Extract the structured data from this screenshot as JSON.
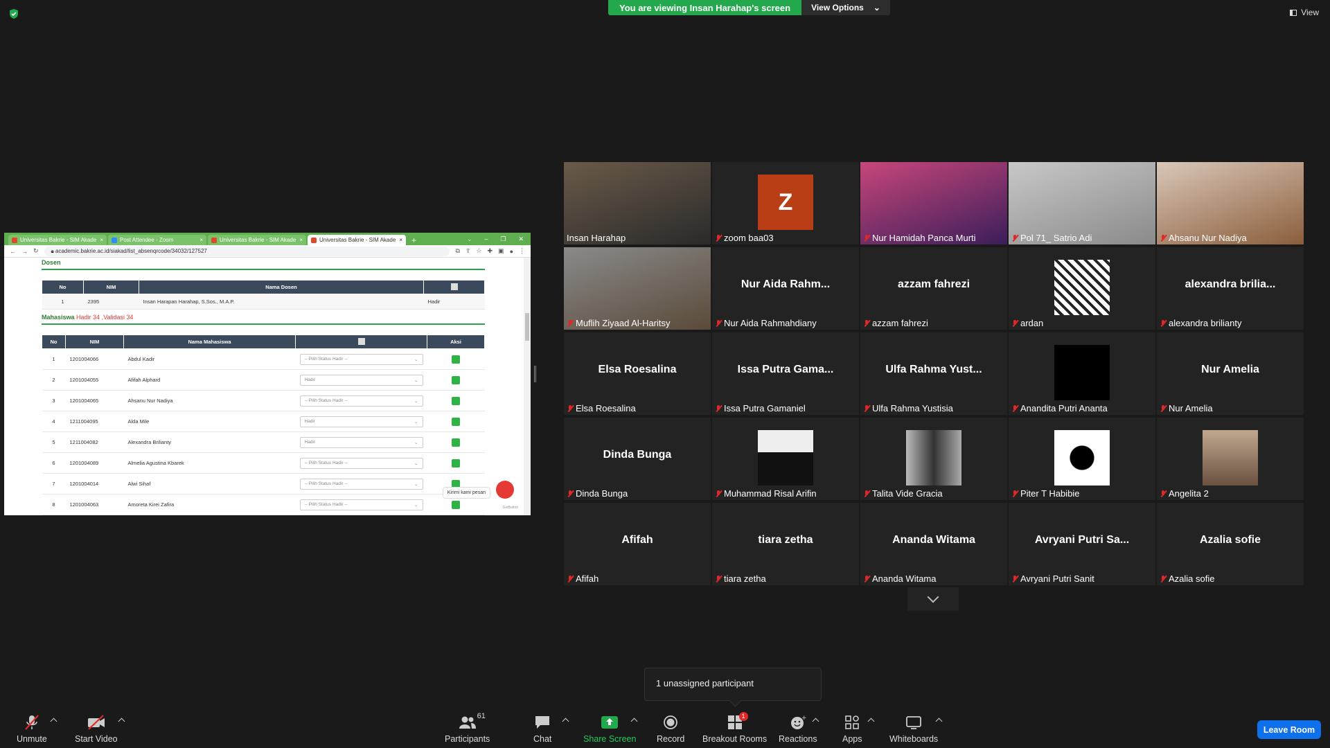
{
  "banner": {
    "viewing": "You are viewing Insan Harahap's screen",
    "view_options": "View Options"
  },
  "view_label": "View",
  "browser": {
    "tabs": [
      "Universitas Bakrie - SIM Akade",
      "Post Attendee - Zoom",
      "Universitas Bakrie - SIM Akade",
      "Universitas Bakrie - SIM Akade"
    ],
    "url": "academic.bakrie.ac.id/siakad/list_absenqrcode/34032/127527"
  },
  "sim": {
    "dosen_title": "Dosen",
    "dosen_headers": [
      "No",
      "NIM",
      "Nama Dosen"
    ],
    "dosen_row": {
      "no": "1",
      "nim": "2395",
      "nama": "Insan Harapan Harahap, S.Sos., M.A.P.",
      "status": "Hadir"
    },
    "mhs_label": "Mahasiswa",
    "mhs_hadir": "Hadir 34",
    "mhs_sep": ",",
    "mhs_validasi": "Validasi 34",
    "mhs_headers": [
      "No",
      "NIM",
      "Nama Mahasiswa",
      "",
      "Aksi"
    ],
    "rows": [
      {
        "no": "1",
        "nim": "1201004066",
        "nama": "Abdul Kadir",
        "status": "-- Pilih Status Hadir --"
      },
      {
        "no": "2",
        "nim": "1201004055",
        "nama": "Afifah Alphard",
        "status": "Hadir"
      },
      {
        "no": "3",
        "nim": "1201004065",
        "nama": "Ahsanu Nur Nadiya",
        "status": "-- Pilih Status Hadir --"
      },
      {
        "no": "4",
        "nim": "1211004095",
        "nama": "Alda Mile",
        "status": "Hadir"
      },
      {
        "no": "5",
        "nim": "1211004082",
        "nama": "Alexandra Brilianty",
        "status": "Hadir"
      },
      {
        "no": "6",
        "nim": "1201004089",
        "nama": "Almelia Agustina Kbarek",
        "status": "-- Pilih Status Hadir --"
      },
      {
        "no": "7",
        "nim": "1201004014",
        "nama": "Alwi Sihaf",
        "status": "-- Pilih Status Hadir --"
      },
      {
        "no": "8",
        "nim": "1201004063",
        "nama": "Amoreta Kirei Zafira",
        "status": "-- Pilih Status Hadir --"
      }
    ],
    "chat_tip": "Kirimi kami pesan",
    "getbutton": "GetButton"
  },
  "participants": [
    {
      "name": "Insan Harahap",
      "big": "",
      "type": "video",
      "muted": false
    },
    {
      "name": "zoom baa03",
      "big": "",
      "type": "letter",
      "letter": "Z",
      "muted": true
    },
    {
      "name": "Nur Hamidah Panca Murti",
      "big": "",
      "type": "video",
      "muted": true
    },
    {
      "name": "Pol 71_ Satrio Adi",
      "big": "",
      "type": "video",
      "muted": true
    },
    {
      "name": "Ahsanu Nur Nadiya",
      "big": "",
      "type": "video",
      "muted": true
    },
    {
      "name": "Muflih Ziyaad Al-Haritsy",
      "big": "",
      "type": "video",
      "muted": true
    },
    {
      "name": "Nur Aida Rahmahdiany",
      "big": "Nur Aida Rahm...",
      "type": "text",
      "muted": true
    },
    {
      "name": "azzam fahrezi",
      "big": "azzam fahrezi",
      "type": "text",
      "muted": true
    },
    {
      "name": "ardan",
      "big": "",
      "type": "pic",
      "muted": true
    },
    {
      "name": "alexandra brilianty",
      "big": "alexandra  brilia...",
      "type": "text",
      "muted": true
    },
    {
      "name": "Elsa Roesalina",
      "big": "Elsa Roesalina",
      "type": "text",
      "muted": true
    },
    {
      "name": "Issa Putra Gamaniel",
      "big": "Issa Putra Gama...",
      "type": "text",
      "muted": true
    },
    {
      "name": "Ulfa Rahma Yustisia",
      "big": "Ulfa Rahma Yust...",
      "type": "text",
      "muted": true
    },
    {
      "name": "Anandita Putri Ananta",
      "big": "",
      "type": "pic",
      "muted": true
    },
    {
      "name": "Nur Amelia",
      "big": "Nur Amelia",
      "type": "text",
      "muted": true
    },
    {
      "name": "Dinda Bunga",
      "big": "Dinda Bunga",
      "type": "text",
      "muted": true
    },
    {
      "name": "Muhammad Risal Arifin",
      "big": "",
      "type": "pic",
      "muted": true
    },
    {
      "name": "Talita Vide Gracia",
      "big": "",
      "type": "pic",
      "muted": true
    },
    {
      "name": "Piter T Habibie",
      "big": "",
      "type": "pic",
      "muted": true
    },
    {
      "name": "Angelita 2",
      "big": "",
      "type": "pic",
      "muted": true
    },
    {
      "name": "Afifah",
      "big": "Afifah",
      "type": "text",
      "muted": true
    },
    {
      "name": "tiara zetha",
      "big": "tiara zetha",
      "type": "text",
      "muted": true
    },
    {
      "name": "Ananda Witama",
      "big": "Ananda Witama",
      "type": "text",
      "muted": true
    },
    {
      "name": "Avryani Putri Sanit",
      "big": "Avryani Putri Sa...",
      "type": "text",
      "muted": true
    },
    {
      "name": "Azalia sofie",
      "big": "Azalia sofie",
      "type": "text",
      "muted": true
    }
  ],
  "tooltip": "1 unassigned participant",
  "toolbar": {
    "unmute": "Unmute",
    "start_video": "Start Video",
    "participants": "Participants",
    "participants_count": "61",
    "chat": "Chat",
    "share_screen": "Share Screen",
    "record": "Record",
    "breakout": "Breakout Rooms",
    "breakout_badge": "1",
    "reactions": "Reactions",
    "apps": "Apps",
    "whiteboards": "Whiteboards",
    "leave": "Leave Room"
  },
  "colors": {
    "share_green": "#23a84e",
    "leave_blue": "#0e71eb",
    "active_speaker": "#c8d93d",
    "muted_red": "#e02828"
  }
}
